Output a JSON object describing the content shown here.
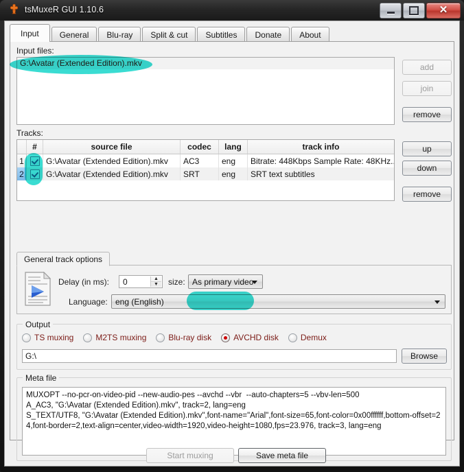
{
  "window": {
    "title": "tsMuxeR GUI 1.10.6",
    "icon": "app-puzzle-icon",
    "buttons": {
      "minimize": "minimize",
      "maximize": "maximize",
      "close": "✕"
    }
  },
  "tabs": [
    {
      "label": "Input",
      "active": true
    },
    {
      "label": "General",
      "active": false
    },
    {
      "label": "Blu-ray",
      "active": false
    },
    {
      "label": "Split & cut",
      "active": false
    },
    {
      "label": "Subtitles",
      "active": false
    },
    {
      "label": "Donate",
      "active": false
    },
    {
      "label": "About",
      "active": false
    }
  ],
  "input_files": {
    "label": "Input files:",
    "items": [
      "G:\\Avatar (Extended Edition).mkv"
    ],
    "buttons": [
      {
        "label": "add",
        "enabled": false
      },
      {
        "label": "join",
        "enabled": false
      },
      {
        "label": "remove",
        "enabled": true
      }
    ]
  },
  "tracks": {
    "label": "Tracks:",
    "columns": [
      "",
      "#",
      "source file",
      "codec",
      "lang",
      "track info"
    ],
    "rows": [
      {
        "index": "1",
        "checked": true,
        "selected": false,
        "source_file": "G:\\Avatar (Extended Edition).mkv",
        "codec": "AC3",
        "lang": "eng",
        "track_info": "Bitrate: 448Kbps Sample Rate: 48KHz..."
      },
      {
        "index": "2",
        "checked": true,
        "selected": true,
        "source_file": "G:\\Avatar (Extended Edition).mkv",
        "codec": "SRT",
        "lang": "eng",
        "track_info": "SRT text subtitles"
      }
    ],
    "buttons": [
      {
        "label": "up",
        "enabled": true
      },
      {
        "label": "down",
        "enabled": true
      },
      {
        "label": "remove",
        "enabled": true
      }
    ]
  },
  "track_options": {
    "tab_label": "General track options",
    "icon": "video-track-icon",
    "delay_label": "Delay (in ms):",
    "delay_value": "0",
    "size_label": "size:",
    "size_value": "As primary video",
    "language_label": "Language:",
    "language_value": "eng (English)"
  },
  "output": {
    "group_label": "Output",
    "modes": [
      {
        "label": "TS muxing",
        "selected": false
      },
      {
        "label": "M2TS muxing",
        "selected": false
      },
      {
        "label": "Blu-ray disk",
        "selected": false
      },
      {
        "label": "AVCHD disk",
        "selected": true
      },
      {
        "label": "Demux",
        "selected": false
      }
    ],
    "path_value": "G:\\",
    "browse_label": "Browse"
  },
  "meta_file": {
    "group_label": "Meta file",
    "lines": [
      "MUXOPT --no-pcr-on-video-pid --new-audio-pes --avchd --vbr  --auto-chapters=5 --vbv-len=500",
      "A_AC3, \"G:\\Avatar (Extended Edition).mkv\", track=2, lang=eng",
      "S_TEXT/UTF8, \"G:\\Avatar (Extended Edition).mkv\",font-name=\"Arial\",font-size=65,font-color=0x00ffffff,bottom-offset=24,font-border=2,text-align=center,video-width=1920,video-height=1080,fps=23.976, track=3, lang=eng"
    ]
  },
  "footer": {
    "start_muxing": {
      "label": "Start muxing",
      "enabled": false
    },
    "save_meta_file": {
      "label": "Save meta file",
      "enabled": true
    }
  },
  "annotations": {
    "highlight_color": "#3adcd2",
    "marks": [
      "input-file-row",
      "track-checkboxes",
      "avchd-disk-option"
    ]
  }
}
